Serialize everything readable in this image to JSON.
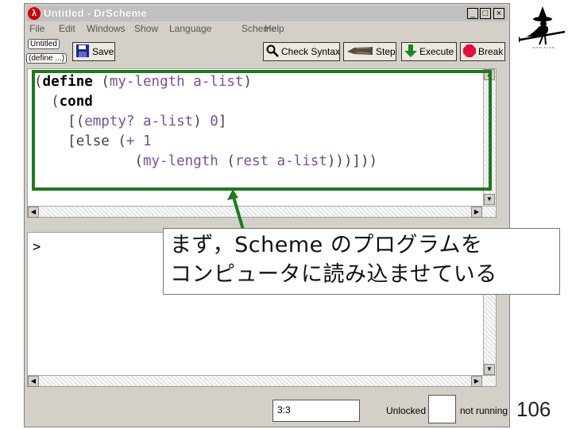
{
  "window": {
    "title": "Untitled - DrScheme",
    "app_icon_glyph": "λ",
    "controls": {
      "minimize": "_",
      "maximize": "□",
      "close": "×"
    }
  },
  "menubar": [
    "File",
    "Edit",
    "Windows",
    "Show",
    "Language",
    "Scheme",
    "Help"
  ],
  "file_buttons": {
    "untitled": "Untitled",
    "define_menu": "(define ...)"
  },
  "toolbar": {
    "save": "Save",
    "check_syntax": "Check Syntax",
    "step": "Step",
    "execute": "Execute",
    "break": "Break"
  },
  "definitions": {
    "lines": [
      "(define (my-length a-list)",
      "  (cond",
      "    [(empty? a-list) 0]",
      "    [else (+ 1",
      "            (my-length (rest a-list)))]))"
    ]
  },
  "interactions": {
    "prompt": ">"
  },
  "status": {
    "position": "3:3",
    "lock_state": "Unlocked",
    "run_state": "not running"
  },
  "callout": {
    "line1": "まず，Scheme のプログラムを",
    "line2": "コンピュータに読み込ませている"
  },
  "slide": {
    "page_number": "106"
  },
  "colors": {
    "highlight_border": "#1d7a1d",
    "keyword": "#000000",
    "identifier": "#7b4f9e",
    "break_icon": "#e0103a",
    "execute_arrow": "#1a8a1a"
  },
  "icons": {
    "logo": "witch-on-broom-logo",
    "save": "floppy-disk-icon",
    "check_syntax": "magnifier-icon",
    "step": "footprints-icon",
    "execute": "green-down-arrow-icon",
    "break": "red-stop-icon"
  }
}
